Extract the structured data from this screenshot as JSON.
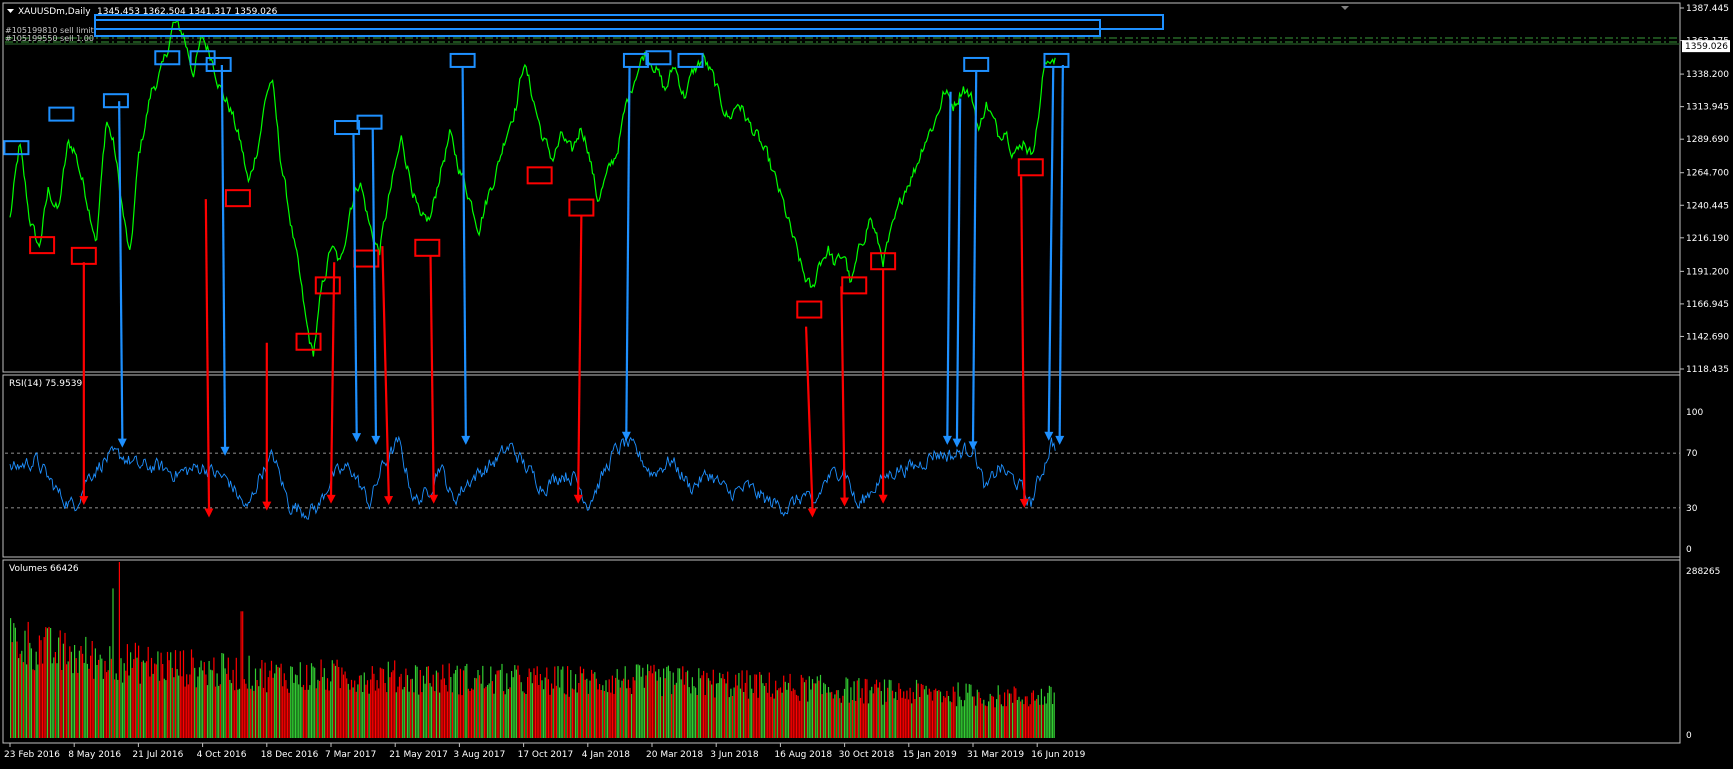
{
  "window": {
    "symbol_title": "XAUUSDm,Daily",
    "ohlc": "1345.453 1362.504 1341.317 1359.026",
    "order_lines": [
      "#105199810 sell limit",
      "#105199550 sell 1.00"
    ]
  },
  "colors": {
    "background": "#000000",
    "price_line": "#00ff00",
    "rsi_line": "#1e90ff",
    "axis_text": "#ffffff",
    "grid_frame": "#c0c0c0",
    "annotation_blue": "#1e90ff",
    "annotation_red": "#ff0000",
    "volume_up": "#32cd32",
    "volume_down": "#ff0000",
    "current_price_label_bg": "#ffffff",
    "order_line": "#3a9a3a"
  },
  "chart_data": [
    {
      "type": "line",
      "name": "price",
      "title": "XAUUSDm,Daily",
      "current_price": "1359.026",
      "price_axis_labels": [
        "1387.445",
        "1363.175",
        "1338.200",
        "1313.945",
        "1289.690",
        "1264.700",
        "1240.445",
        "1216.190",
        "1191.200",
        "1166.945",
        "1142.690",
        "1118.435"
      ],
      "ylim": [
        1118.435,
        1387.445
      ],
      "x": [
        "23 Feb 2016",
        "8 May 2016",
        "21 Jul 2016",
        "4 Oct 2016",
        "18 Dec 2016",
        "7 Mar 2017",
        "21 May 2017",
        "3 Aug 2017",
        "17 Oct 2017",
        "4 Jan 2018",
        "20 Mar 2018",
        "3 Jun 2018",
        "16 Aug 2018",
        "30 Oct 2018",
        "15 Jan 2019",
        "31 Mar 2019",
        "16 Jun 2019"
      ],
      "anchors": [
        [
          0,
          1230
        ],
        [
          0.15,
          1285
        ],
        [
          0.3,
          1232
        ],
        [
          0.45,
          1208
        ],
        [
          0.6,
          1252
        ],
        [
          0.75,
          1235
        ],
        [
          0.9,
          1285
        ],
        [
          1.0,
          1283
        ],
        [
          1.2,
          1245
        ],
        [
          1.35,
          1215
        ],
        [
          1.5,
          1305
        ],
        [
          1.62,
          1285
        ],
        [
          1.75,
          1238
        ],
        [
          1.87,
          1200
        ],
        [
          2.0,
          1275
        ],
        [
          2.2,
          1325
        ],
        [
          2.38,
          1342
        ],
        [
          2.55,
          1376
        ],
        [
          2.7,
          1368
        ],
        [
          2.85,
          1340
        ],
        [
          3.0,
          1365
        ],
        [
          3.15,
          1350
        ],
        [
          3.3,
          1325
        ],
        [
          3.45,
          1310
        ],
        [
          3.6,
          1285
        ],
        [
          3.72,
          1255
        ],
        [
          3.88,
          1290
        ],
        [
          4.0,
          1325
        ],
        [
          4.08,
          1335
        ],
        [
          4.2,
          1280
        ],
        [
          4.35,
          1235
        ],
        [
          4.5,
          1190
        ],
        [
          4.62,
          1150
        ],
        [
          4.72,
          1128
        ],
        [
          4.85,
          1175
        ],
        [
          5.0,
          1210
        ],
        [
          5.15,
          1195
        ],
        [
          5.3,
          1240
        ],
        [
          5.45,
          1260
        ],
        [
          5.6,
          1225
        ],
        [
          5.75,
          1205
        ],
        [
          5.9,
          1245
        ],
        [
          6.1,
          1290
        ],
        [
          6.25,
          1258
        ],
        [
          6.4,
          1226
        ],
        [
          6.55,
          1230
        ],
        [
          6.7,
          1265
        ],
        [
          6.85,
          1292
        ],
        [
          7.0,
          1268
        ],
        [
          7.15,
          1248
        ],
        [
          7.3,
          1225
        ],
        [
          7.45,
          1248
        ],
        [
          7.6,
          1270
        ],
        [
          7.75,
          1298
        ],
        [
          7.9,
          1318
        ],
        [
          8.0,
          1348
        ],
        [
          8.15,
          1320
        ],
        [
          8.3,
          1290
        ],
        [
          8.45,
          1275
        ],
        [
          8.6,
          1292
        ],
        [
          8.75,
          1278
        ],
        [
          8.9,
          1300
        ],
        [
          9.0,
          1285
        ],
        [
          9.15,
          1245
        ],
        [
          9.3,
          1262
        ],
        [
          9.45,
          1280
        ],
        [
          9.6,
          1315
        ],
        [
          9.75,
          1340
        ],
        [
          9.9,
          1355
        ],
        [
          10.05,
          1345
        ],
        [
          10.2,
          1325
        ],
        [
          10.35,
          1345
        ],
        [
          10.5,
          1322
        ],
        [
          10.65,
          1340
        ],
        [
          10.8,
          1350
        ],
        [
          10.95,
          1335
        ],
        [
          11.05,
          1320
        ],
        [
          11.2,
          1305
        ],
        [
          11.35,
          1318
        ],
        [
          11.5,
          1302
        ],
        [
          11.65,
          1290
        ],
        [
          11.8,
          1275
        ],
        [
          11.95,
          1255
        ],
        [
          12.05,
          1240
        ],
        [
          12.2,
          1215
        ],
        [
          12.35,
          1190
        ],
        [
          12.5,
          1175
        ],
        [
          12.6,
          1198
        ],
        [
          12.75,
          1208
        ],
        [
          12.85,
          1195
        ],
        [
          13.0,
          1205
        ],
        [
          13.1,
          1180
        ],
        [
          13.25,
          1210
        ],
        [
          13.4,
          1232
        ],
        [
          13.5,
          1215
        ],
        [
          13.6,
          1200
        ],
        [
          13.75,
          1222
        ],
        [
          13.85,
          1238
        ],
        [
          13.95,
          1255
        ],
        [
          14.1,
          1268
        ],
        [
          14.25,
          1290
        ],
        [
          14.4,
          1302
        ],
        [
          14.55,
          1325
        ],
        [
          14.7,
          1315
        ],
        [
          14.85,
          1330
        ],
        [
          15.0,
          1318
        ],
        [
          15.1,
          1295
        ],
        [
          15.2,
          1318
        ],
        [
          15.3,
          1305
        ],
        [
          15.4,
          1292
        ],
        [
          15.5,
          1300
        ],
        [
          15.6,
          1285
        ],
        [
          15.7,
          1280
        ],
        [
          15.8,
          1290
        ],
        [
          15.9,
          1278
        ],
        [
          16.0,
          1300
        ],
        [
          16.1,
          1340
        ],
        [
          16.2,
          1350
        ],
        [
          16.28,
          1352
        ]
      ]
    },
    {
      "type": "line",
      "name": "rsi",
      "title": "RSI(14) 75.9539",
      "levels": [
        70,
        30
      ],
      "y_labels": [
        "100",
        "70",
        "30",
        "0"
      ],
      "ylim": [
        0,
        100
      ],
      "anchors": [
        [
          0,
          58
        ],
        [
          0.4,
          65
        ],
        [
          0.8,
          38
        ],
        [
          1.0,
          31
        ],
        [
          1.2,
          52
        ],
        [
          1.5,
          66
        ],
        [
          1.75,
          68
        ],
        [
          2.0,
          60
        ],
        [
          2.3,
          60
        ],
        [
          2.6,
          55
        ],
        [
          3.0,
          60
        ],
        [
          3.4,
          50
        ],
        [
          3.7,
          28
        ],
        [
          3.9,
          55
        ],
        [
          4.1,
          68
        ],
        [
          4.35,
          32
        ],
        [
          4.6,
          28
        ],
        [
          4.8,
          30
        ],
        [
          5.0,
          52
        ],
        [
          5.3,
          60
        ],
        [
          5.6,
          33
        ],
        [
          5.8,
          60
        ],
        [
          6.05,
          78
        ],
        [
          6.3,
          35
        ],
        [
          6.5,
          40
        ],
        [
          6.7,
          62
        ],
        [
          6.9,
          35
        ],
        [
          7.15,
          50
        ],
        [
          7.5,
          62
        ],
        [
          7.8,
          75
        ],
        [
          8.0,
          62
        ],
        [
          8.3,
          45
        ],
        [
          8.6,
          55
        ],
        [
          8.8,
          52
        ],
        [
          9.0,
          33
        ],
        [
          9.2,
          50
        ],
        [
          9.4,
          70
        ],
        [
          9.6,
          78
        ],
        [
          9.8,
          68
        ],
        [
          10.0,
          55
        ],
        [
          10.3,
          65
        ],
        [
          10.6,
          45
        ],
        [
          10.9,
          55
        ],
        [
          11.2,
          40
        ],
        [
          11.5,
          45
        ],
        [
          11.8,
          35
        ],
        [
          12.1,
          30
        ],
        [
          12.4,
          40
        ],
        [
          12.5,
          28
        ],
        [
          12.7,
          50
        ],
        [
          13.0,
          60
        ],
        [
          13.2,
          30
        ],
        [
          13.5,
          48
        ],
        [
          13.8,
          58
        ],
        [
          14.1,
          60
        ],
        [
          14.4,
          70
        ],
        [
          14.7,
          68
        ],
        [
          15.0,
          75
        ],
        [
          15.2,
          42
        ],
        [
          15.4,
          60
        ],
        [
          15.7,
          48
        ],
        [
          15.9,
          33
        ],
        [
          16.1,
          60
        ],
        [
          16.22,
          78
        ],
        [
          16.28,
          76
        ]
      ]
    },
    {
      "type": "bar",
      "name": "volumes",
      "title": "Volumes 66426",
      "y_labels": [
        "288265",
        "0"
      ],
      "ylim": [
        0,
        288265
      ],
      "levels": [
        [
          0,
          0.58
        ],
        [
          0.7,
          0.5
        ],
        [
          1.5,
          0.45
        ],
        [
          2.5,
          0.42
        ],
        [
          3.5,
          0.38
        ],
        [
          4.5,
          0.36
        ],
        [
          5.5,
          0.36
        ],
        [
          6.5,
          0.35
        ],
        [
          7.5,
          0.34
        ],
        [
          8.5,
          0.33
        ],
        [
          9.5,
          0.34
        ],
        [
          10.5,
          0.33
        ],
        [
          11.5,
          0.31
        ],
        [
          12.5,
          0.29
        ],
        [
          13.5,
          0.27
        ],
        [
          14.5,
          0.26
        ],
        [
          15.5,
          0.24
        ],
        [
          16.28,
          0.24
        ]
      ],
      "spikes": [
        [
          1.6,
          0.85
        ],
        [
          1.7,
          1.0
        ],
        [
          3.6,
          0.72
        ]
      ]
    }
  ],
  "annotations": {
    "blue_boxes": [
      [
        0.1,
        1283
      ],
      [
        0.8,
        1308
      ],
      [
        1.65,
        1318
      ],
      [
        2.45,
        1350
      ],
      [
        3.0,
        1350
      ],
      [
        3.25,
        1345
      ],
      [
        5.25,
        1298
      ],
      [
        5.6,
        1302
      ],
      [
        7.05,
        1348
      ],
      [
        9.75,
        1348
      ],
      [
        10.1,
        1350
      ],
      [
        10.6,
        1348
      ],
      [
        15.05,
        1345
      ],
      [
        16.3,
        1348
      ]
    ],
    "red_boxes": [
      [
        0.5,
        1210
      ],
      [
        1.15,
        1202
      ],
      [
        3.55,
        1245
      ],
      [
        4.65,
        1138
      ],
      [
        4.95,
        1180
      ],
      [
        5.55,
        1200
      ],
      [
        6.5,
        1208
      ],
      [
        8.25,
        1262
      ],
      [
        8.9,
        1238
      ],
      [
        12.45,
        1162
      ],
      [
        13.15,
        1180
      ],
      [
        13.6,
        1198
      ],
      [
        15.9,
        1268
      ]
    ],
    "blue_arrows": [
      [
        1.7,
        1318,
        1.75,
        74
      ],
      [
        3.3,
        1345,
        3.35,
        68
      ],
      [
        5.35,
        1293,
        5.4,
        78
      ],
      [
        5.65,
        1297,
        5.7,
        76
      ],
      [
        7.05,
        1343,
        7.1,
        76
      ],
      [
        9.65,
        1343,
        9.6,
        79
      ],
      [
        14.65,
        1325,
        14.6,
        76
      ],
      [
        14.8,
        1320,
        14.75,
        74
      ],
      [
        15.05,
        1340,
        15.0,
        72
      ],
      [
        16.25,
        1343,
        16.18,
        79
      ],
      [
        16.4,
        1345,
        16.35,
        76
      ]
    ],
    "red_arrows": [
      [
        1.15,
        1198,
        1.15,
        32
      ],
      [
        3.05,
        1245,
        3.1,
        23
      ],
      [
        4.0,
        1138,
        4.0,
        28
      ],
      [
        5.05,
        1198,
        5.0,
        33
      ],
      [
        5.8,
        1210,
        5.9,
        32
      ],
      [
        6.55,
        1203,
        6.6,
        33
      ],
      [
        8.9,
        1233,
        8.85,
        33
      ],
      [
        12.4,
        1150,
        12.5,
        23
      ],
      [
        12.95,
        1180,
        13.0,
        31
      ],
      [
        13.6,
        1193,
        13.6,
        33
      ],
      [
        15.75,
        1262,
        15.8,
        30
      ]
    ]
  }
}
